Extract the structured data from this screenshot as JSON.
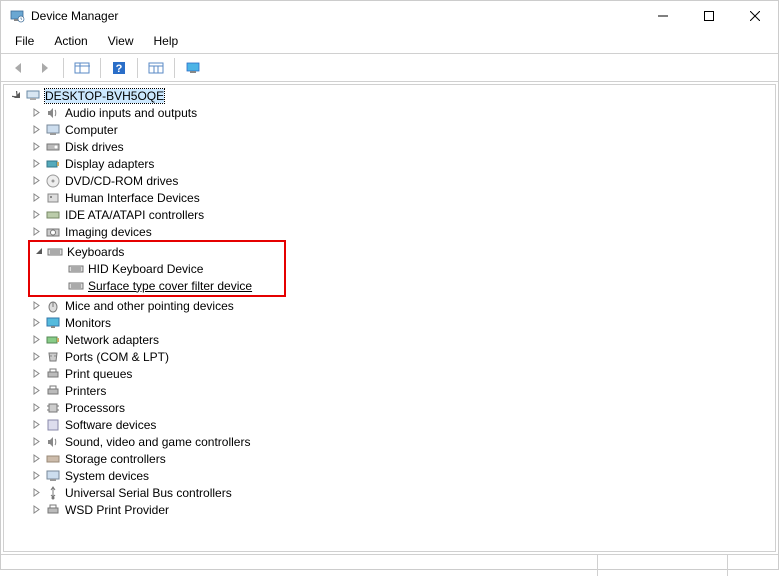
{
  "window": {
    "title": "Device Manager"
  },
  "menu": {
    "file": "File",
    "action": "Action",
    "view": "View",
    "help": "Help"
  },
  "tree": {
    "root": "DESKTOP-BVH5OQE",
    "categories": [
      {
        "label": "Audio inputs and outputs"
      },
      {
        "label": "Computer"
      },
      {
        "label": "Disk drives"
      },
      {
        "label": "Display adapters"
      },
      {
        "label": "DVD/CD-ROM drives"
      },
      {
        "label": "Human Interface Devices"
      },
      {
        "label": "IDE ATA/ATAPI controllers"
      },
      {
        "label": "Imaging devices"
      },
      {
        "label": "Keyboards"
      },
      {
        "label": "Mice and other pointing devices"
      },
      {
        "label": "Monitors"
      },
      {
        "label": "Network adapters"
      },
      {
        "label": "Ports (COM & LPT)"
      },
      {
        "label": "Print queues"
      },
      {
        "label": "Printers"
      },
      {
        "label": "Processors"
      },
      {
        "label": "Software devices"
      },
      {
        "label": "Sound, video and game controllers"
      },
      {
        "label": "Storage controllers"
      },
      {
        "label": "System devices"
      },
      {
        "label": "Universal Serial Bus controllers"
      },
      {
        "label": "WSD Print Provider"
      }
    ],
    "keyboard_children": [
      {
        "label": "HID Keyboard Device"
      },
      {
        "label": "Surface type cover filter device"
      }
    ]
  }
}
